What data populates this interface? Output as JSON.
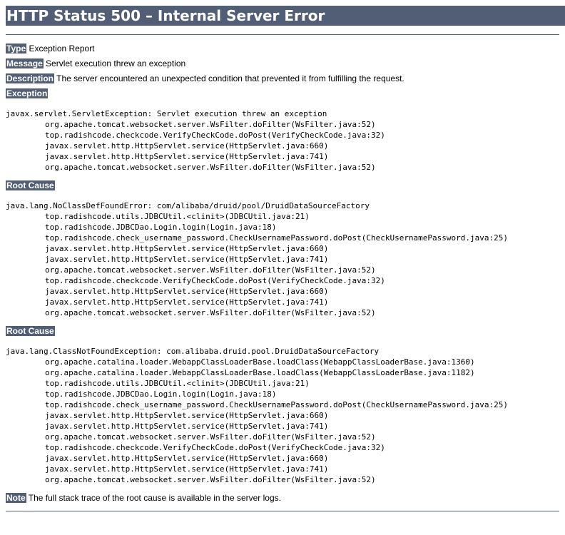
{
  "title": "HTTP Status 500 – Internal Server Error",
  "type": {
    "label": "Type",
    "value": "Exception Report"
  },
  "message": {
    "label": "Message",
    "value": "Servlet execution threw an exception"
  },
  "description": {
    "label": "Description",
    "value": "The server encountered an unexpected condition that prevented it from fulfilling the request."
  },
  "exception": {
    "heading": "Exception",
    "first_line": "javax.servlet.ServletException: Servlet execution threw an exception",
    "frames": [
      "org.apache.tomcat.websocket.server.WsFilter.doFilter(WsFilter.java:52)",
      "top.radishcode.checkcode.VerifyCheckCode.doPost(VerifyCheckCode.java:32)",
      "javax.servlet.http.HttpServlet.service(HttpServlet.java:660)",
      "javax.servlet.http.HttpServlet.service(HttpServlet.java:741)",
      "org.apache.tomcat.websocket.server.WsFilter.doFilter(WsFilter.java:52)"
    ]
  },
  "root_causes": [
    {
      "heading": "Root Cause",
      "first_line": "java.lang.NoClassDefFoundError: com/alibaba/druid/pool/DruidDataSourceFactory",
      "frames": [
        "top.radishcode.utils.JDBCUtil.<clinit>(JDBCUtil.java:21)",
        "top.radishcode.JDBCDao.Login.login(Login.java:18)",
        "top.radishcode.check_username_password.CheckUsernamePassword.doPost(CheckUsernamePassword.java:25)",
        "javax.servlet.http.HttpServlet.service(HttpServlet.java:660)",
        "javax.servlet.http.HttpServlet.service(HttpServlet.java:741)",
        "org.apache.tomcat.websocket.server.WsFilter.doFilter(WsFilter.java:52)",
        "top.radishcode.checkcode.VerifyCheckCode.doPost(VerifyCheckCode.java:32)",
        "javax.servlet.http.HttpServlet.service(HttpServlet.java:660)",
        "javax.servlet.http.HttpServlet.service(HttpServlet.java:741)",
        "org.apache.tomcat.websocket.server.WsFilter.doFilter(WsFilter.java:52)"
      ]
    },
    {
      "heading": "Root Cause",
      "first_line": "java.lang.ClassNotFoundException: com.alibaba.druid.pool.DruidDataSourceFactory",
      "frames": [
        "org.apache.catalina.loader.WebappClassLoaderBase.loadClass(WebappClassLoaderBase.java:1360)",
        "org.apache.catalina.loader.WebappClassLoaderBase.loadClass(WebappClassLoaderBase.java:1182)",
        "top.radishcode.utils.JDBCUtil.<clinit>(JDBCUtil.java:21)",
        "top.radishcode.JDBCDao.Login.login(Login.java:18)",
        "top.radishcode.check_username_password.CheckUsernamePassword.doPost(CheckUsernamePassword.java:25)",
        "javax.servlet.http.HttpServlet.service(HttpServlet.java:660)",
        "javax.servlet.http.HttpServlet.service(HttpServlet.java:741)",
        "org.apache.tomcat.websocket.server.WsFilter.doFilter(WsFilter.java:52)",
        "top.radishcode.checkcode.VerifyCheckCode.doPost(VerifyCheckCode.java:32)",
        "javax.servlet.http.HttpServlet.service(HttpServlet.java:660)",
        "javax.servlet.http.HttpServlet.service(HttpServlet.java:741)",
        "org.apache.tomcat.websocket.server.WsFilter.doFilter(WsFilter.java:52)"
      ]
    }
  ],
  "note": {
    "label": "Note",
    "value": "The full stack trace of the root cause is available in the server logs."
  },
  "colors": {
    "header_bg": "#525D76",
    "header_fg": "#FFFFFF",
    "text": "#000000"
  }
}
